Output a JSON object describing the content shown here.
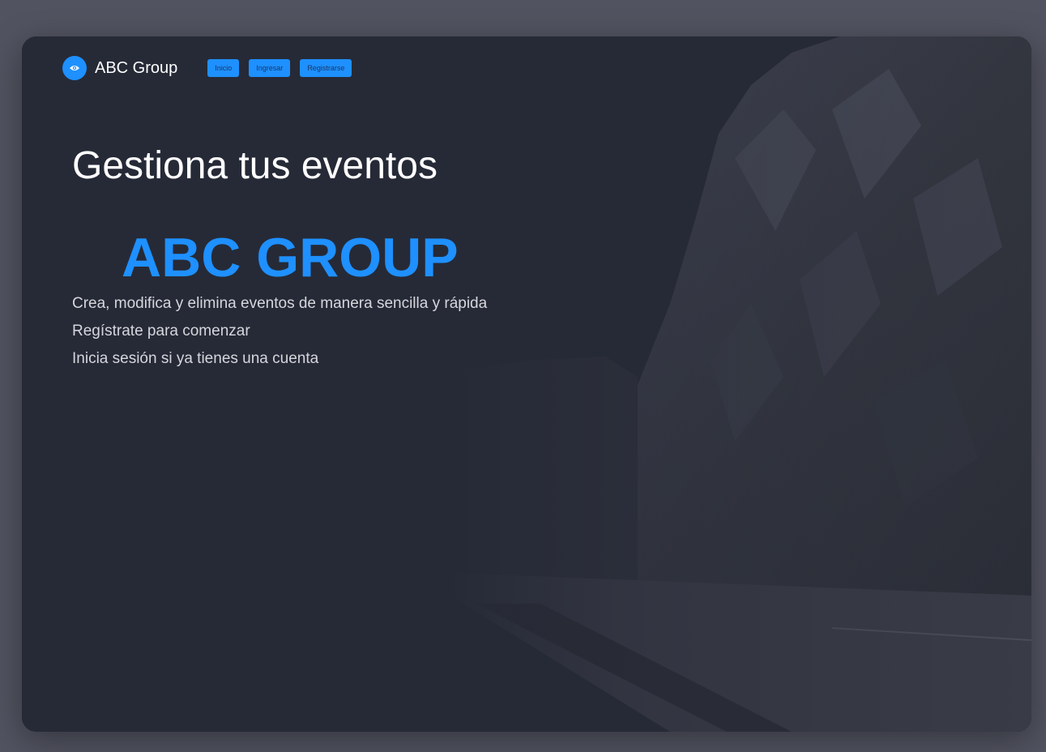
{
  "colors": {
    "page_background": "#515360",
    "card_background": "#262a37",
    "accent": "#1e90ff",
    "heading_text": "#ffffff",
    "body_text": "#d6d6dc",
    "button_text": "#1b3766"
  },
  "navbar": {
    "logo_icon": "eye-icon",
    "brand": "ABC Group",
    "links": [
      {
        "label": "Inicio"
      },
      {
        "label": "Ingresar"
      },
      {
        "label": "Registrarse"
      }
    ]
  },
  "hero": {
    "title": "Gestiona tus eventos",
    "brand": "ABC GROUP",
    "lines": [
      "Crea, modifica y elimina eventos de manera sencilla y rápida",
      "Regístrate para comenzar",
      "Inicia sesión si ya tienes una cuenta"
    ]
  },
  "background": {
    "image": "dark mountain cliff photograph"
  }
}
